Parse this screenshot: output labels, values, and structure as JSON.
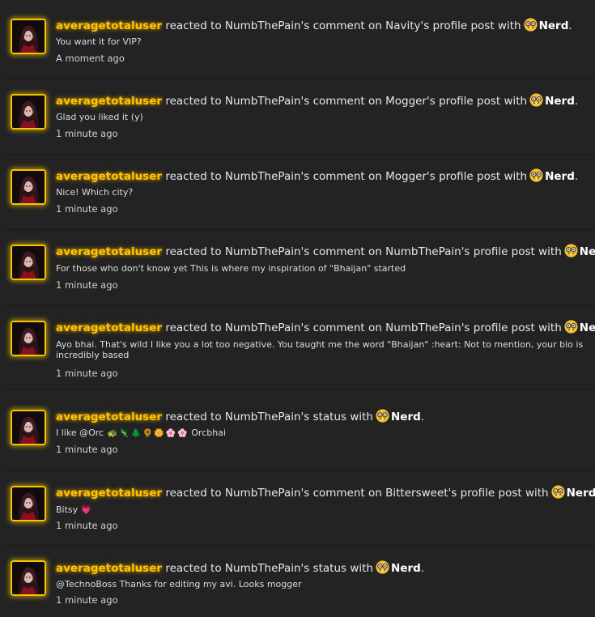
{
  "colors": {
    "background": "#232323",
    "username": "#ffc400",
    "text": "#e6e6e6",
    "divider": "#191919"
  },
  "items": [
    {
      "username": "averagetotaluser",
      "verb": "reacted to",
      "actor": "NumbThePain's",
      "object_text": "comment on",
      "target": "Navity's",
      "object_tail": "profile post with",
      "reaction": "Nerd",
      "period": ".",
      "snippet": "You want it for VIP?",
      "time": "A moment ago"
    },
    {
      "username": "averagetotaluser",
      "verb": "reacted to",
      "actor": "NumbThePain's",
      "object_text": "comment on",
      "target": "Mogger's",
      "object_tail": "profile post with",
      "reaction": "Nerd",
      "period": ".",
      "snippet": "Glad you liked it (y)",
      "time": "1 minute ago"
    },
    {
      "username": "averagetotaluser",
      "verb": "reacted to",
      "actor": "NumbThePain's",
      "object_text": "comment on",
      "target": "Mogger's",
      "object_tail": "profile post with",
      "reaction": "Nerd",
      "period": ".",
      "snippet": "Nice! Which city?",
      "time": "1 minute ago"
    },
    {
      "username": "averagetotaluser",
      "verb": "reacted to",
      "actor": "NumbThePain's",
      "object_text": "comment on",
      "target": "NumbThePain's",
      "object_tail": "profile post with",
      "reaction": "Nerd",
      "period": ".",
      "snippet": "For those who don't know yet This is where my inspiration of \"Bhaijan\" started",
      "time": "1 minute ago"
    },
    {
      "username": "averagetotaluser",
      "verb": "reacted to",
      "actor": "NumbThePain's",
      "object_text": "comment on",
      "target": "NumbThePain's",
      "object_tail": "profile post with",
      "reaction": "Nerd",
      "period": ".",
      "snippet": "Ayo bhai. That's wild I like you a lot too negative. You taught me the word \"Bhaijan\" :heart: Not to mention, your bio is incredibly based",
      "time": "1 minute ago"
    },
    {
      "username": "averagetotaluser",
      "verb": "reacted to",
      "actor": "NumbThePain's",
      "object_text": "status with",
      "target": "",
      "object_tail": "",
      "reaction": "Nerd",
      "period": ".",
      "snippet_prefix": "I like @Orc",
      "snippet_emojis": [
        "🐢",
        "🦎",
        "🌲",
        "🌻",
        "🌼",
        "🌸",
        "🌸"
      ],
      "snippet_suffix": "Orcbhai",
      "time": "1 minute ago"
    },
    {
      "username": "averagetotaluser",
      "verb": "reacted to",
      "actor": "NumbThePain's",
      "object_text": "comment on",
      "target": "Bittersweet's",
      "object_tail": "profile post with",
      "reaction": "Nerd",
      "period": ".",
      "snippet": "Bitsy",
      "snippet_heart": "💗",
      "time": "1 minute ago"
    },
    {
      "username": "averagetotaluser",
      "verb": "reacted to",
      "actor": "NumbThePain's",
      "object_text": "status with",
      "target": "",
      "object_tail": "",
      "reaction": "Nerd",
      "period": ".",
      "snippet": "@TechnoBoss Thanks for editing my avi. Looks mogger",
      "time": "1 minute ago"
    }
  ]
}
